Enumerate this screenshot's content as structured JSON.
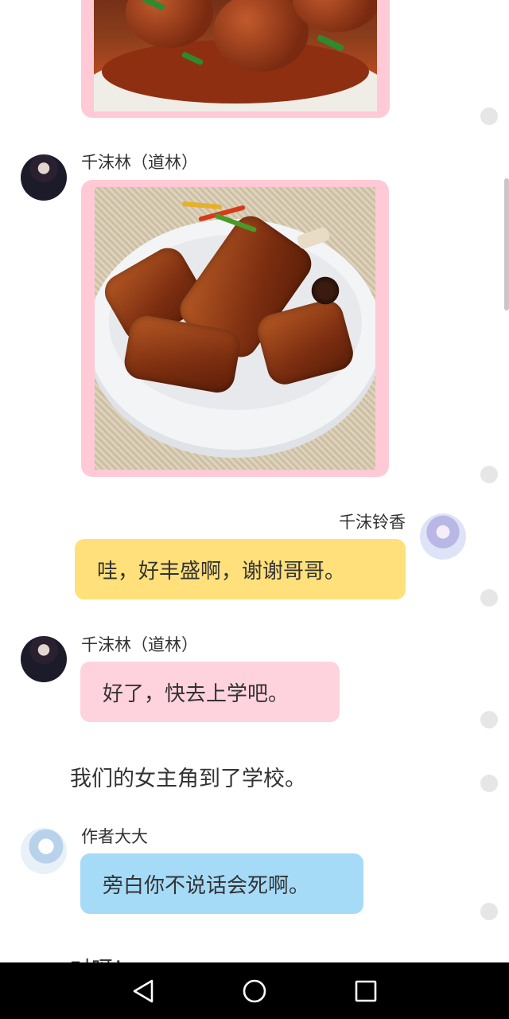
{
  "messages": {
    "daolin_name": "千沫林（道林）",
    "lingxiang_name": "千沫铃香",
    "author_name": "作者大大",
    "lingxiang_msg": "哇，好丰盛啊，谢谢哥哥。",
    "daolin_msg": "好了，快去上学吧。",
    "narration": "我们的女主角到了学校。",
    "author_msg": "旁白你不说话会死啊。",
    "cut_text": "对呀！"
  },
  "colors": {
    "pink_bubble": "#ffd3de",
    "yellow_bubble": "#ffe07a",
    "blue_bubble": "#a6dbf8",
    "image_frame": "#ffc9d6",
    "navbar": "#000000"
  },
  "icons": {
    "back": "triangle-back-icon",
    "home": "circle-home-icon",
    "recents": "square-recents-icon"
  }
}
